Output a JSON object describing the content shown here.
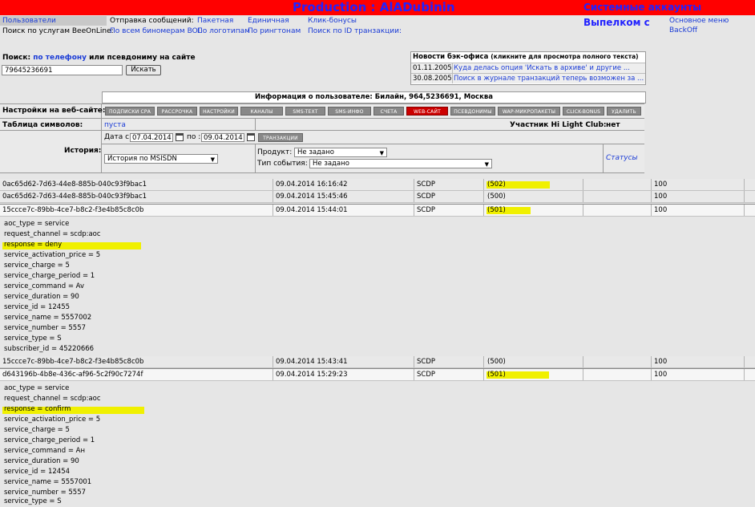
{
  "header": {
    "title": "Production : AlADubinin",
    "banner": "Системные аккаунты Выпелком с"
  },
  "menu": {
    "users": "Пользователи",
    "send_messages_label": "Отправка сообщений:",
    "batch": "Пакетная",
    "single": "Единичная",
    "click_bonuses": "Клик-бонусы",
    "main_menu": "Основное меню BackOff",
    "services_search_label": "Поиск по услугам BeeOnLine:",
    "all_binomials": "По всем биномерам BOL",
    "by_logos": "По логотипам",
    "by_ringtones": "По рингтонам",
    "by_transaction_id": "Поиск по ID транзакции:"
  },
  "search": {
    "label_prefix": "Поиск:",
    "by_phone": "по телефону",
    "label_suffix": "или псевдониму на сайте",
    "phone_value": "79645236691",
    "button": "Искать"
  },
  "news": {
    "title": "Новости бэк-офиса",
    "hint": "(кликните для просмотра полного текста)",
    "items": [
      {
        "date": "01.11.2005",
        "text": "Куда делась опция 'Искать в архиве' и другие ..."
      },
      {
        "date": "30.08.2005",
        "text": "Поиск в журнале транзакций теперь возможен за ..."
      }
    ]
  },
  "user": {
    "info": "Информация о пользователе: Билайн, 964,5236691, Москва",
    "settings_label": "Настройки на веб-сайте:",
    "tabs": [
      "ПОДПИСКИ СРА",
      "РАССРОЧКА",
      "НАСТРОЙКИ",
      "КАНАЛЫ",
      "SMS-TEXT",
      "SMS-ИНФО",
      "СЧЕТА",
      "WEB-САЙТ",
      "ПСЕВДОНИМЫ",
      "WAP-МИКРОПАКЕТЫ",
      "CLICK-BONUS",
      "УДАЛИТЬ"
    ],
    "charset_label": "Таблица символов:",
    "charset_value": "пуста",
    "club_label": "Участник Hi Light Club:",
    "club_value": "нет",
    "history_label": "История:",
    "date_from_label": "Дата с:",
    "date_from": "07.04.2014",
    "date_to_label": "по :",
    "date_to": "09.04.2014",
    "transactions_button": "ТРАНЗАКЦИИ",
    "history_select": "История по MSISDN",
    "product_label": "Продукт:",
    "product_value": "Не задано",
    "event_type_label": "Тип события:",
    "event_type_value": "Не задано",
    "statuses_link": "Статусы"
  },
  "rows": [
    {
      "id": "0ac65d62-7d63-44e8-885b-040c93f9bac1",
      "time": "09.04.2014 16:16:42",
      "type": "SCDP",
      "code": "(502)",
      "amount": "100",
      "highlight": true
    },
    {
      "id": "0ac65d62-7d63-44e8-885b-040c93f9bac1",
      "time": "09.04.2014 15:45:46",
      "type": "SCDP",
      "code": "(500)",
      "amount": "100",
      "highlight": false
    },
    {
      "id": "15ccce7c-89bb-4ce7-b8c2-f3e4b85c8c0b",
      "time": "09.04.2014 15:44:01",
      "type": "SCDP",
      "code": "(501)",
      "amount": "100",
      "highlight": true
    },
    {
      "id": "15ccce7c-89bb-4ce7-b8c2-f3e4b85c8c0b",
      "time": "09.04.2014 15:43:41",
      "type": "SCDP",
      "code": "(500)",
      "amount": "100",
      "highlight": false
    },
    {
      "id": "d643196b-4b8e-436c-af96-5c2f90c7274f",
      "time": "09.04.2014 15:29:23",
      "type": "SCDP",
      "code": "(501)",
      "amount": "100",
      "highlight": true
    }
  ],
  "details1": [
    "aoc_type = service",
    "request_channel = scdp:aoc",
    "response = deny",
    "service_activation_price = 5",
    "service_charge = 5",
    "service_charge_period = 1",
    "service_command = Av",
    "service_duration = 90",
    "service_id = 12455",
    "service_name = 5557002",
    "service_number = 5557",
    "service_type = S",
    "subscriber_id = 45220666"
  ],
  "details2": [
    "aoc_type = service",
    "request_channel = scdp:aoc",
    "response = confirm",
    "service_activation_price = 5",
    "service_charge = 5",
    "service_charge_period = 1",
    "service_command = Ан",
    "service_duration = 90",
    "service_id = 12454",
    "service_name = 5557001",
    "service_number = 5557",
    "service_type = S"
  ],
  "colors": {
    "top_bar": "#ff0000",
    "title": "#2222ff",
    "highlight": "#f0f000",
    "active_tab": "#cc0000"
  }
}
